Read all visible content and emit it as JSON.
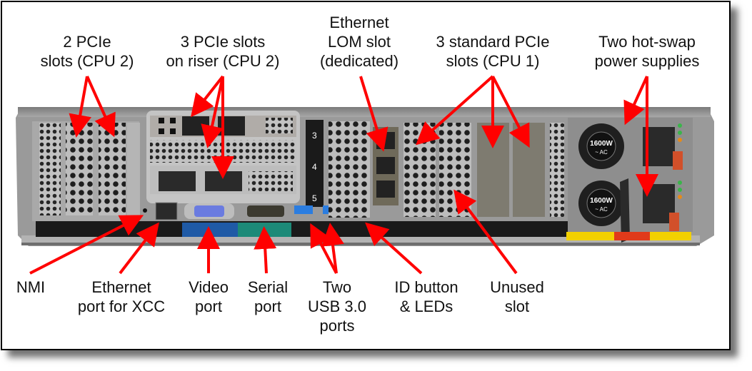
{
  "diagram": {
    "title": "Server rear view with labeled components",
    "top_labels": [
      {
        "id": "pcie-cpu2",
        "text": "2 PCIe\nslots (CPU 2)"
      },
      {
        "id": "riser-cpu2",
        "text": "3 PCIe slots\non riser (CPU 2)"
      },
      {
        "id": "lom",
        "text": "Ethernet\nLOM slot\n(dedicated)"
      },
      {
        "id": "pcie-cpu1",
        "text": "3 standard PCIe\nslots (CPU 1)"
      },
      {
        "id": "psu",
        "text": "Two hot-swap\npower supplies"
      }
    ],
    "bottom_labels": [
      {
        "id": "nmi",
        "text": "NMI"
      },
      {
        "id": "xcc",
        "text": "Ethernet\nport for XCC"
      },
      {
        "id": "video",
        "text": "Video\nport"
      },
      {
        "id": "serial",
        "text": "Serial\nport"
      },
      {
        "id": "usb",
        "text": "Two\nUSB 3.0\nports"
      },
      {
        "id": "idbtn",
        "text": "ID button\n& LEDs"
      },
      {
        "id": "unused",
        "text": "Unused\nslot"
      }
    ],
    "riser_slot_numbers": [
      "3",
      "4",
      "5"
    ],
    "psu_rating": [
      "1600W",
      "~ AC"
    ],
    "colors": {
      "arrow": "#ff0000",
      "chassis": "#8c8c8c",
      "video_band": "#1f5aa6",
      "serial_band": "#1c8a78",
      "psu_warning_yellow": "#f2d000",
      "psu_handle_orange": "#d2502a",
      "led_green": "#3ab54a",
      "led_amber": "#e58a1a",
      "usb_blue": "#2b7de0"
    }
  }
}
